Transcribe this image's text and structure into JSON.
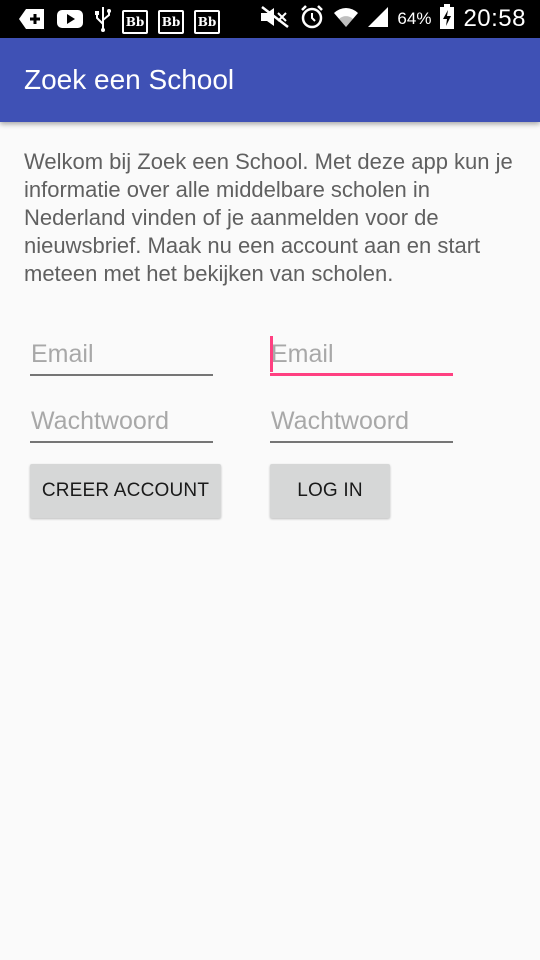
{
  "status_bar": {
    "icons_left": [
      "add-box-icon",
      "youtube-icon",
      "usb-icon",
      "bb-icon",
      "bb-icon",
      "bb-icon"
    ],
    "bb_label": "Bb",
    "icons_right": [
      "mute-icon",
      "alarm-icon",
      "wifi-icon",
      "signal-icon",
      "battery-icon"
    ],
    "battery_percent": "64%",
    "time": "20:58"
  },
  "app_bar": {
    "title": "Zoek een School",
    "color": "#3f51b5"
  },
  "intro_text": "Welkom bij Zoek een School. Met deze app kun je informatie over alle middelbare scholen in Nederland vinden of je aanmelden voor de nieuwsbrief. Maak nu een account aan en start meteen met het bekijken van scholen.",
  "register": {
    "email_placeholder": "Email",
    "password_placeholder": "Wachtwoord",
    "button_label": "CREER ACCOUNT"
  },
  "login": {
    "email_placeholder": "Email",
    "password_placeholder": "Wachtwoord",
    "button_label": "LOG IN"
  },
  "accent_color": "#ff4081"
}
